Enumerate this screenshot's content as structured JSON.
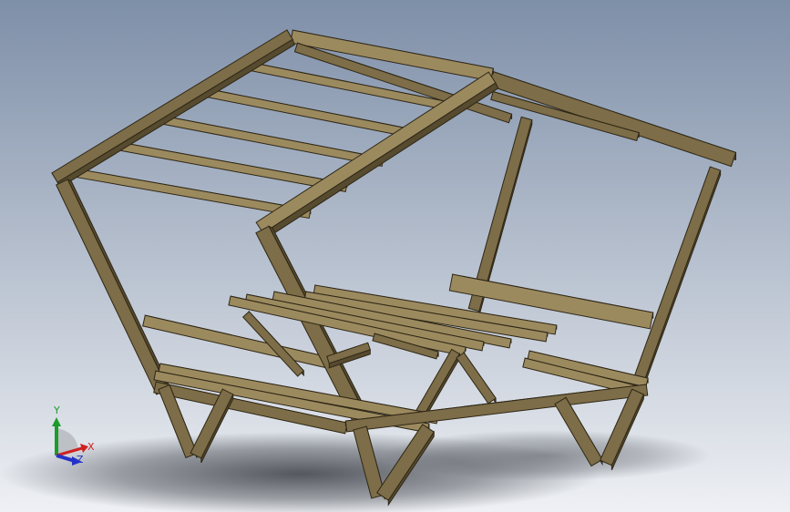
{
  "colors": {
    "background_top": "#7e8fa8",
    "background_bottom": "#eef0f4",
    "wood_light": "#9c8a5f",
    "wood_mid": "#7d6d48",
    "wood_dark": "#564a2f",
    "wood_edge": "#2e2716",
    "shadow": "#3a3e45",
    "axis_x": "#d12020",
    "axis_y": "#1c9c2a",
    "axis_z": "#2432c8"
  },
  "model": {
    "name": "picnic-table-with-canopy"
  },
  "triad": {
    "x_label": "X",
    "y_label": "Y",
    "z_label": "Z"
  }
}
